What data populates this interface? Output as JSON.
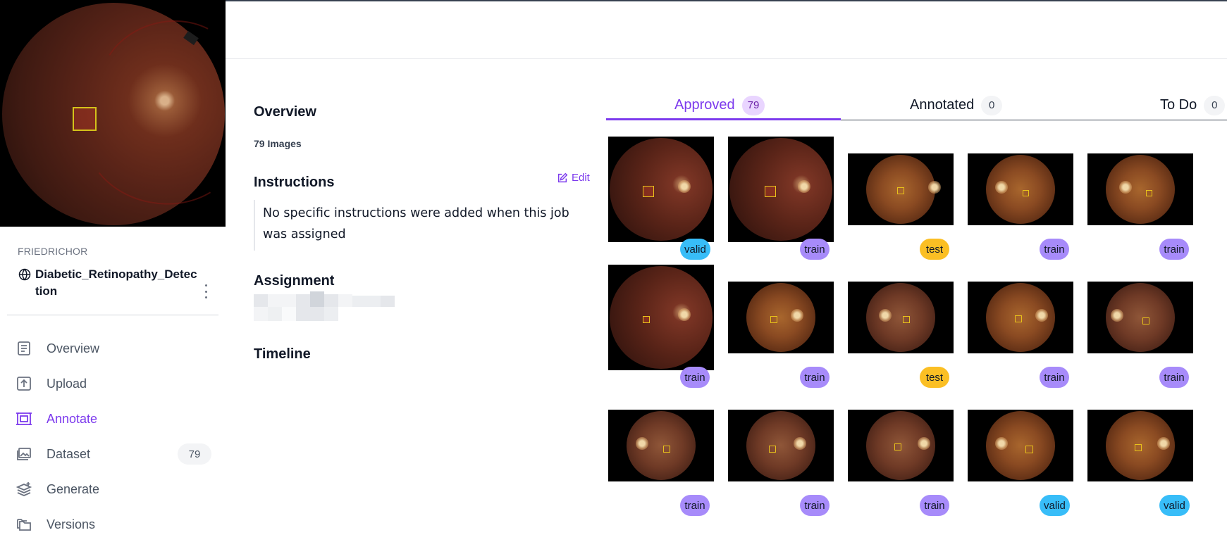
{
  "sidebar": {
    "owner": "FRIEDRICHOR",
    "project_name": "Diabetic_Retinopathy_Detection",
    "nav": [
      {
        "label": "Overview",
        "icon": "document-icon"
      },
      {
        "label": "Upload",
        "icon": "upload-icon"
      },
      {
        "label": "Annotate",
        "icon": "annotate-icon",
        "active": true
      },
      {
        "label": "Dataset",
        "icon": "images-icon",
        "count": "79"
      },
      {
        "label": "Generate",
        "icon": "layers-plus-icon"
      },
      {
        "label": "Versions",
        "icon": "folders-icon"
      }
    ]
  },
  "overview": {
    "title": "Overview",
    "image_count": "79 Images",
    "instructions_title": "Instructions",
    "edit_label": "Edit",
    "instructions_text": "No specific instructions were added when this job was assigned",
    "assignment_title": "Assignment",
    "timeline_title": "Timeline"
  },
  "tabs": [
    {
      "label": "Approved",
      "count": "79",
      "active": true
    },
    {
      "label": "Annotated",
      "count": "0"
    },
    {
      "label": "To Do",
      "count": "0"
    }
  ],
  "colors": {
    "accent": "#7c3aed",
    "valid": "#38bdf8",
    "train": "#a78bfa",
    "test": "#fbbf24"
  },
  "grid": [
    [
      {
        "split": "valid"
      },
      {
        "split": "train"
      },
      {
        "split": "test"
      },
      {
        "split": "train"
      },
      {
        "split": "train"
      }
    ],
    [
      {
        "split": "train"
      },
      {
        "split": "train"
      },
      {
        "split": "test"
      },
      {
        "split": "train"
      },
      {
        "split": "train"
      }
    ],
    [
      {
        "split": "train"
      },
      {
        "split": "train"
      },
      {
        "split": "train"
      },
      {
        "split": "valid"
      },
      {
        "split": "valid"
      }
    ]
  ]
}
